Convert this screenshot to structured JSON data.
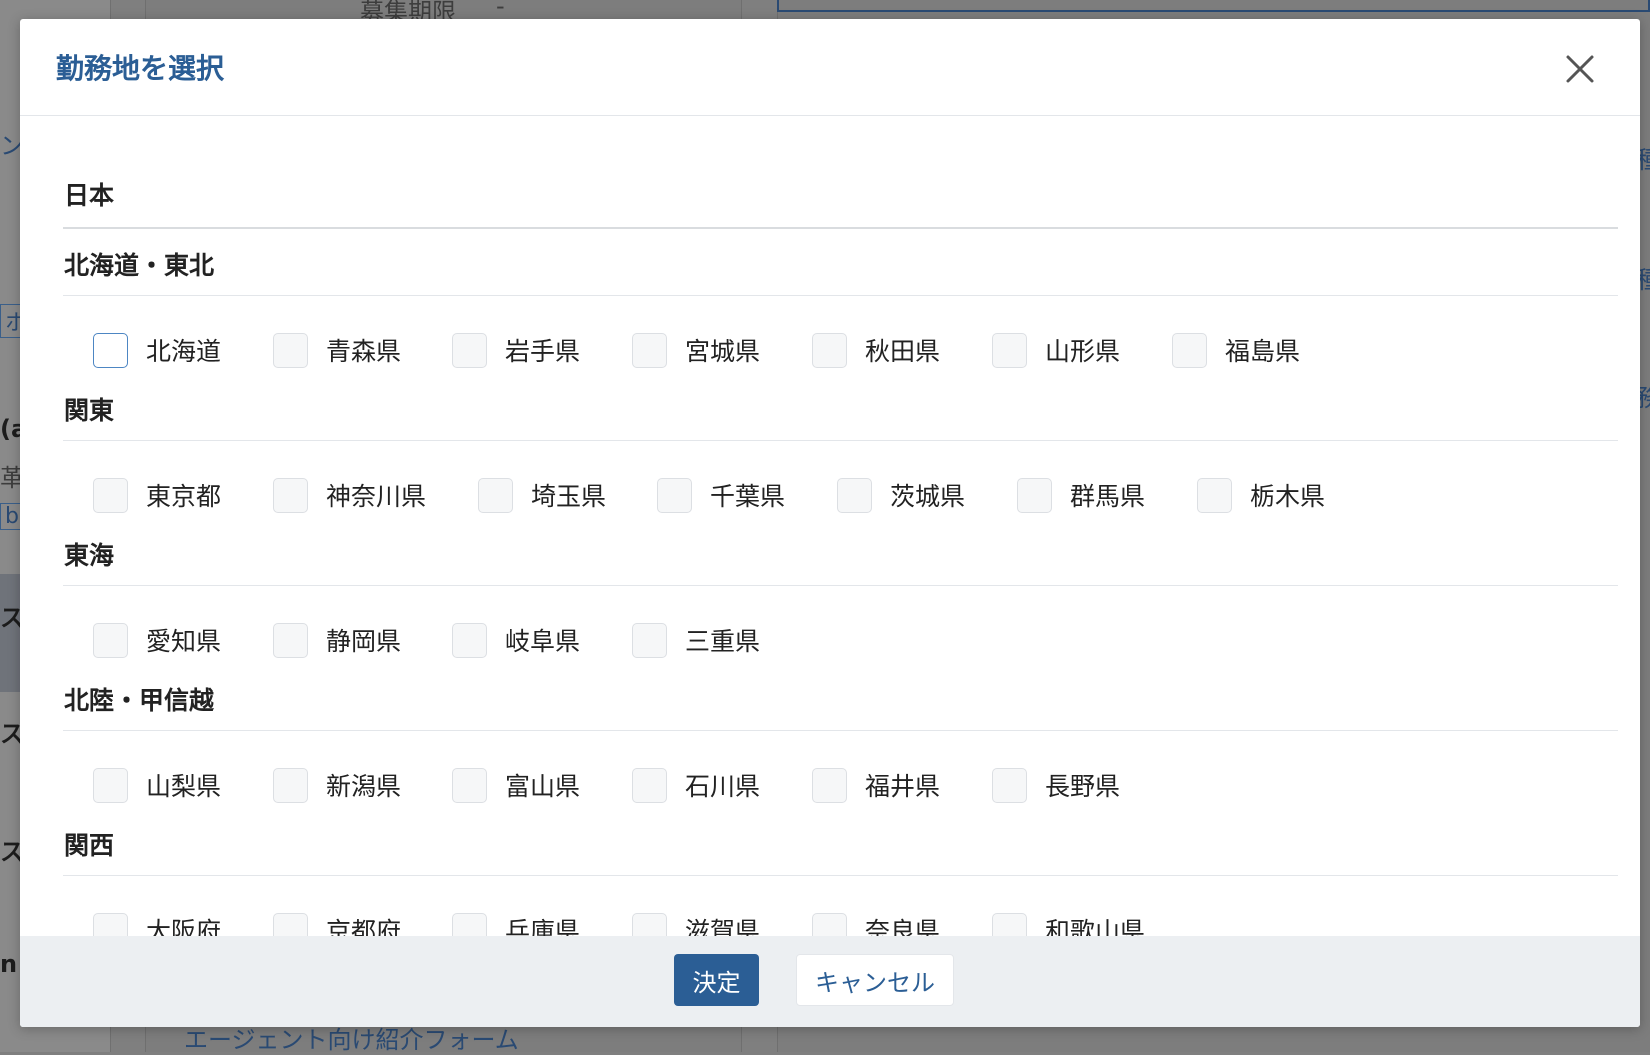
{
  "background": {
    "top_label": "募集期限",
    "top_dash": "-",
    "bottom_link": "エージェント向け紹介フォーム",
    "left_fragments": [
      "ン",
      "ホ",
      "(a",
      "革",
      "b&",
      "ス|",
      "ス|",
      "ス|",
      "n"
    ],
    "right_fragments": [
      "種",
      "種",
      "務"
    ]
  },
  "modal": {
    "title": "勤務地を選択",
    "close_label": "閉じる",
    "country": "日本",
    "sections": [
      {
        "title": "北海道・東北",
        "options": [
          "北海道",
          "青森県",
          "岩手県",
          "宮城県",
          "秋田県",
          "山形県",
          "福島県"
        ]
      },
      {
        "title": "関東",
        "options": [
          "東京都",
          "神奈川県",
          "埼玉県",
          "千葉県",
          "茨城県",
          "群馬県",
          "栃木県"
        ]
      },
      {
        "title": "東海",
        "options": [
          "愛知県",
          "静岡県",
          "岐阜県",
          "三重県"
        ]
      },
      {
        "title": "北陸・甲信越",
        "options": [
          "山梨県",
          "新潟県",
          "富山県",
          "石川県",
          "福井県",
          "長野県"
        ]
      },
      {
        "title": "関西",
        "options": [
          "大阪府",
          "京都府",
          "兵庫県",
          "滋賀県",
          "奈良県",
          "和歌山県"
        ]
      }
    ],
    "confirm_label": "決定",
    "cancel_label": "キャンセル"
  },
  "colors": {
    "accent": "#2b5e95",
    "footer_bg": "#eceff2",
    "overlay": "#7f7f7f"
  }
}
